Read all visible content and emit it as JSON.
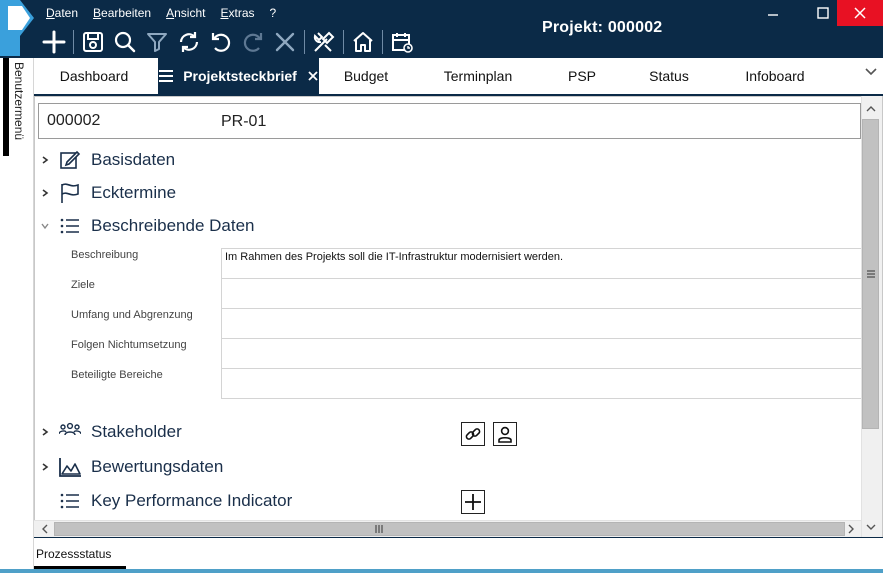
{
  "menu": {
    "items": [
      "Daten",
      "Bearbeiten",
      "Ansicht",
      "Extras",
      "?"
    ],
    "mnemonics": [
      "D",
      "B",
      "A",
      "E",
      ""
    ]
  },
  "toolbar": {
    "icons": [
      "plus-icon",
      "save-icon",
      "search-icon",
      "filter-icon",
      "refresh-icon",
      "undo-icon",
      "redo-icon",
      "cancel-icon",
      "tools-icon",
      "home-icon",
      "calendar-icon"
    ]
  },
  "window": {
    "title": "Projekt: 000002"
  },
  "sidebar": {
    "label": "Benutzermenü"
  },
  "tabs": [
    {
      "label": "Dashboard",
      "active": false
    },
    {
      "label": "Projektsteckbrief",
      "active": true
    },
    {
      "label": "Budget",
      "active": false
    },
    {
      "label": "Terminplan",
      "active": false
    },
    {
      "label": "PSP",
      "active": false
    },
    {
      "label": "Status",
      "active": false
    },
    {
      "label": "Infoboard",
      "active": false
    }
  ],
  "project": {
    "number": "000002",
    "code": "PR-01"
  },
  "sections": [
    {
      "title": "Basisdaten",
      "icon": "edit-icon",
      "expanded": false
    },
    {
      "title": "Ecktermine",
      "icon": "flag-icon",
      "expanded": false
    },
    {
      "title": "Beschreibende Daten",
      "icon": "list-icon",
      "expanded": true
    },
    {
      "title": "Stakeholder",
      "icon": "people-icon",
      "expanded": false
    },
    {
      "title": "Bewertungsdaten",
      "icon": "chart-area-icon",
      "expanded": false
    },
    {
      "title": "Key Performance Indicator",
      "icon": "list-icon",
      "expanded": false
    }
  ],
  "fields": [
    {
      "label": "Beschreibung",
      "value": "Im Rahmen des Projekts soll die IT-Infrastruktur modernisiert werden."
    },
    {
      "label": "Ziele",
      "value": ""
    },
    {
      "label": "Umfang und Abgrenzung",
      "value": ""
    },
    {
      "label": "Folgen Nichtumsetzung",
      "value": ""
    },
    {
      "label": "Beteiligte Bereiche",
      "value": ""
    }
  ],
  "status": {
    "label": "Prozessstatus"
  },
  "colors": {
    "frame": "#0b2a47",
    "accent": "#4fa0c8",
    "close": "#e81123"
  }
}
